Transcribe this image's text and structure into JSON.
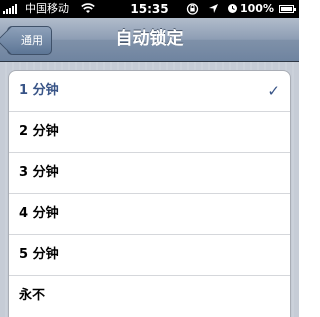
{
  "status_bar": {
    "carrier": "中国移动",
    "time": "15:35",
    "battery": "100%"
  },
  "nav": {
    "back_label": "通用",
    "title": "自动锁定"
  },
  "options": [
    {
      "label": "1 分钟",
      "selected": true
    },
    {
      "label": "2 分钟",
      "selected": false
    },
    {
      "label": "3 分钟",
      "selected": false
    },
    {
      "label": "4 分钟",
      "selected": false
    },
    {
      "label": "5 分钟",
      "selected": false
    },
    {
      "label": "永不",
      "selected": false
    }
  ],
  "icons": {
    "signal": "signal-icon",
    "wifi": "wifi-icon",
    "rotation_lock": "rotation-lock-icon",
    "location": "location-arrow-icon",
    "alarm": "alarm-icon",
    "battery": "battery-icon",
    "check": "checkmark-icon"
  },
  "colors": {
    "selected_text": "#385487",
    "nav_bar": "#8d9db4"
  }
}
